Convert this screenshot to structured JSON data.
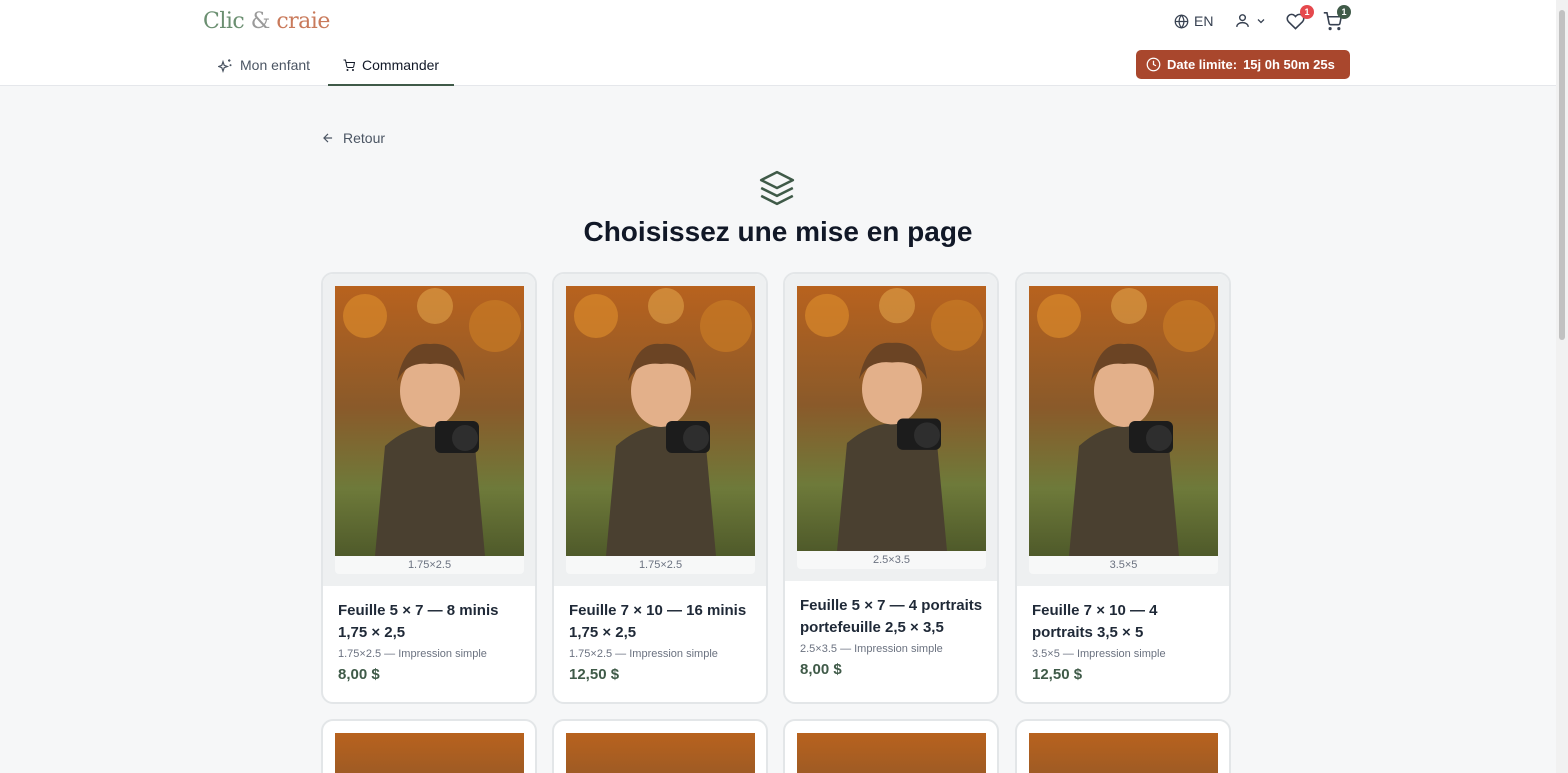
{
  "header": {
    "logo": {
      "part1": "Clic",
      "amp": "&",
      "part2": "craie"
    },
    "language": "EN",
    "favorites_count": "1",
    "cart_count": "1"
  },
  "nav": {
    "tabs": [
      {
        "label": "Mon enfant",
        "active": false
      },
      {
        "label": "Commander",
        "active": true
      }
    ]
  },
  "deadline": {
    "label": "Date limite:",
    "value": "15j 0h 50m 25s"
  },
  "page": {
    "back_label": "Retour",
    "title": "Choisissez une mise en page"
  },
  "cards": [
    {
      "size": "1.75×2.5",
      "name": "Feuille 5 × 7 — 8 minis 1,75 × 2,5",
      "sub": "1.75×2.5 — Impression simple",
      "price": "8,00 $"
    },
    {
      "size": "1.75×2.5",
      "name": "Feuille 7 × 10 — 16 minis 1,75 × 2,5",
      "sub": "1.75×2.5 — Impression simple",
      "price": "12,50 $"
    },
    {
      "size": "2.5×3.5",
      "name": "Feuille 5 × 7 — 4 portraits portefeuille 2,5 × 3,5",
      "sub": "2.5×3.5 — Impression simple",
      "price": "8,00 $"
    },
    {
      "size": "3.5×5",
      "name": "Feuille 7 × 10 — 4 portraits 3,5 × 5",
      "sub": "3.5×5 — Impression simple",
      "price": "12,50 $"
    }
  ],
  "colors": {
    "accent": "#3f5a48",
    "deadline": "#a9472d",
    "badge_red": "#e5484d"
  }
}
